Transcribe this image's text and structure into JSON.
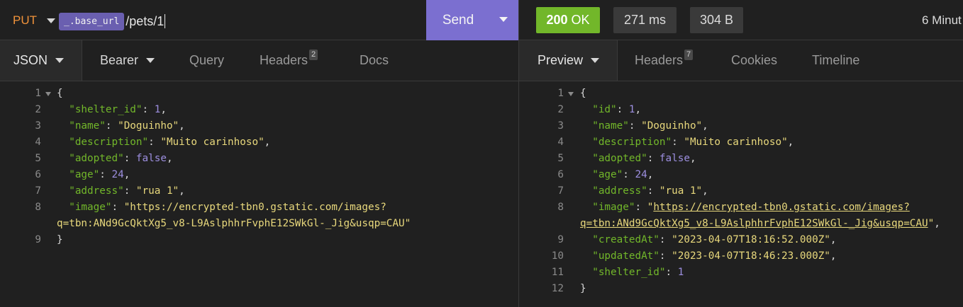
{
  "request": {
    "method": "PUT",
    "env_tag": "_.base_url",
    "path": "/pets/1",
    "send_label": "Send"
  },
  "response": {
    "status_code": "200",
    "status_text": "OK",
    "time": "271 ms",
    "size": "304 B",
    "age": "6 Minut"
  },
  "left_tabs": {
    "json": "JSON",
    "bearer": "Bearer",
    "query": "Query",
    "headers": "Headers",
    "headers_count": "2",
    "docs": "Docs"
  },
  "right_tabs": {
    "preview": "Preview",
    "headers": "Headers",
    "headers_count": "7",
    "cookies": "Cookies",
    "timeline": "Timeline"
  },
  "request_body": [
    {
      "n": "1",
      "fold": true,
      "t": [
        [
          "p",
          "{"
        ]
      ]
    },
    {
      "n": "2",
      "t": [
        [
          "p",
          "  "
        ],
        [
          "k",
          "\"shelter_id\""
        ],
        [
          "p",
          ": "
        ],
        [
          "n",
          "1"
        ],
        [
          "p",
          ","
        ]
      ]
    },
    {
      "n": "3",
      "t": [
        [
          "p",
          "  "
        ],
        [
          "k",
          "\"name\""
        ],
        [
          "p",
          ": "
        ],
        [
          "s",
          "\"Doguinho\""
        ],
        [
          "p",
          ","
        ]
      ]
    },
    {
      "n": "4",
      "t": [
        [
          "p",
          "  "
        ],
        [
          "k",
          "\"description\""
        ],
        [
          "p",
          ": "
        ],
        [
          "s",
          "\"Muito carinhoso\""
        ],
        [
          "p",
          ","
        ]
      ]
    },
    {
      "n": "5",
      "t": [
        [
          "p",
          "  "
        ],
        [
          "k",
          "\"adopted\""
        ],
        [
          "p",
          ": "
        ],
        [
          "n",
          "false"
        ],
        [
          "p",
          ","
        ]
      ]
    },
    {
      "n": "6",
      "t": [
        [
          "p",
          "  "
        ],
        [
          "k",
          "\"age\""
        ],
        [
          "p",
          ": "
        ],
        [
          "n",
          "24"
        ],
        [
          "p",
          ","
        ]
      ]
    },
    {
      "n": "7",
      "t": [
        [
          "p",
          "  "
        ],
        [
          "k",
          "\"address\""
        ],
        [
          "p",
          ": "
        ],
        [
          "s",
          "\"rua 1\""
        ],
        [
          "p",
          ","
        ]
      ]
    },
    {
      "n": "8",
      "t": [
        [
          "p",
          "  "
        ],
        [
          "k",
          "\"image\""
        ],
        [
          "p",
          ": "
        ],
        [
          "s",
          "\"https://encrypted-tbn0.gstatic.com/images?"
        ]
      ]
    },
    {
      "n": "",
      "t": [
        [
          "s",
          "q=tbn:ANd9GcQktXg5_v8-L9AslphhrFvphE12SWkGl-_Jig&usqp=CAU\""
        ]
      ]
    },
    {
      "n": "9",
      "t": [
        [
          "p",
          "}"
        ]
      ]
    }
  ],
  "response_body": [
    {
      "n": "1",
      "fold": true,
      "t": [
        [
          "p",
          "{"
        ]
      ]
    },
    {
      "n": "2",
      "t": [
        [
          "p",
          "  "
        ],
        [
          "k",
          "\"id\""
        ],
        [
          "p",
          ": "
        ],
        [
          "n",
          "1"
        ],
        [
          "p",
          ","
        ]
      ]
    },
    {
      "n": "3",
      "t": [
        [
          "p",
          "  "
        ],
        [
          "k",
          "\"name\""
        ],
        [
          "p",
          ": "
        ],
        [
          "s",
          "\"Doguinho\""
        ],
        [
          "p",
          ","
        ]
      ]
    },
    {
      "n": "4",
      "t": [
        [
          "p",
          "  "
        ],
        [
          "k",
          "\"description\""
        ],
        [
          "p",
          ": "
        ],
        [
          "s",
          "\"Muito carinhoso\""
        ],
        [
          "p",
          ","
        ]
      ]
    },
    {
      "n": "5",
      "t": [
        [
          "p",
          "  "
        ],
        [
          "k",
          "\"adopted\""
        ],
        [
          "p",
          ": "
        ],
        [
          "n",
          "false"
        ],
        [
          "p",
          ","
        ]
      ]
    },
    {
      "n": "6",
      "t": [
        [
          "p",
          "  "
        ],
        [
          "k",
          "\"age\""
        ],
        [
          "p",
          ": "
        ],
        [
          "n",
          "24"
        ],
        [
          "p",
          ","
        ]
      ]
    },
    {
      "n": "7",
      "t": [
        [
          "p",
          "  "
        ],
        [
          "k",
          "\"address\""
        ],
        [
          "p",
          ": "
        ],
        [
          "s",
          "\"rua 1\""
        ],
        [
          "p",
          ","
        ]
      ]
    },
    {
      "n": "8",
      "t": [
        [
          "p",
          "  "
        ],
        [
          "k",
          "\"image\""
        ],
        [
          "p",
          ": "
        ],
        [
          "s",
          "\""
        ],
        [
          "lnk",
          "https://encrypted-tbn0.gstatic.com/images?"
        ]
      ]
    },
    {
      "n": "",
      "t": [
        [
          "lnk",
          "q=tbn:ANd9GcQktXg5_v8-L9AslphhrFvphE12SWkGl-_Jig&usqp=CAU"
        ],
        [
          "s",
          "\""
        ],
        [
          "p",
          ","
        ]
      ]
    },
    {
      "n": "9",
      "t": [
        [
          "p",
          "  "
        ],
        [
          "k",
          "\"createdAt\""
        ],
        [
          "p",
          ": "
        ],
        [
          "s",
          "\"2023-04-07T18:16:52.000Z\""
        ],
        [
          "p",
          ","
        ]
      ]
    },
    {
      "n": "10",
      "t": [
        [
          "p",
          "  "
        ],
        [
          "k",
          "\"updatedAt\""
        ],
        [
          "p",
          ": "
        ],
        [
          "s",
          "\"2023-04-07T18:46:23.000Z\""
        ],
        [
          "p",
          ","
        ]
      ]
    },
    {
      "n": "11",
      "t": [
        [
          "p",
          "  "
        ],
        [
          "k",
          "\"shelter_id\""
        ],
        [
          "p",
          ": "
        ],
        [
          "n",
          "1"
        ]
      ]
    },
    {
      "n": "12",
      "t": [
        [
          "p",
          "}"
        ]
      ]
    }
  ],
  "colors": {
    "background": "#202020",
    "accent": "#7b6fd0",
    "status_ok": "#72b72a",
    "method": "#f0923a",
    "json_key": "#72b72a",
    "json_string": "#e8d87c",
    "json_number": "#9d8fe0"
  }
}
